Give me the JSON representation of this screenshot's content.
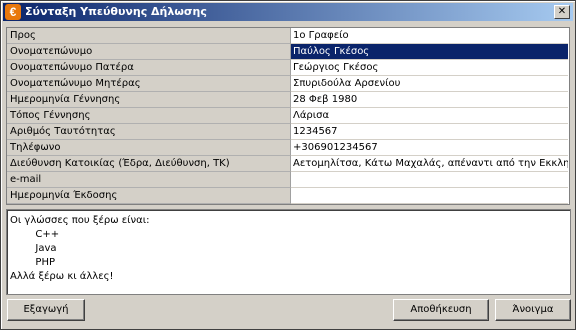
{
  "window": {
    "title": "Σύνταξη Υπεύθυνης Δήλωσης",
    "icon_letter": "€",
    "close_label": "✕"
  },
  "form": {
    "rows": [
      {
        "label": "Προς",
        "value": "1ο Γραφείο"
      },
      {
        "label": "Ονοματεπώνυμο",
        "value": "Παύλος Γκέσος",
        "selected": true
      },
      {
        "label": "Ονοματεπώνυμο Πατέρα",
        "value": "Γεώργιος Γκέσος"
      },
      {
        "label": "Ονοματεπώνυμο Μητέρας",
        "value": "Σπυριδούλα Αρσενίου"
      },
      {
        "label": "Ημερομηνία Γέννησης",
        "value": "28 Φεβ 1980"
      },
      {
        "label": "Τόπος Γέννησης",
        "value": "Λάρισα"
      },
      {
        "label": "Αριθμός Ταυτότητας",
        "value": "1234567"
      },
      {
        "label": "Τηλέφωνο",
        "value": "+306901234567"
      },
      {
        "label": "Διεύθυνση Κατοικίας (Έδρα, Διεύθυνση, ΤΚ)",
        "value": "Αετομηλίτσα, Κάτω Μαχαλάς, απέναντι από την Εκκλησία"
      },
      {
        "label": "e-mail",
        "value": ""
      },
      {
        "label": "Ημερομηνία Έκδοσης",
        "value": ""
      }
    ]
  },
  "notes": {
    "lines": [
      "Οι γλώσσες που ξέρω είναι:",
      "        C++",
      "        Java",
      "        PHP",
      "Αλλά ξέρω κι άλλες!"
    ]
  },
  "buttons": {
    "export": "Εξαγωγή",
    "save": "Αποθήκευση",
    "open": "Άνοιγμα"
  }
}
